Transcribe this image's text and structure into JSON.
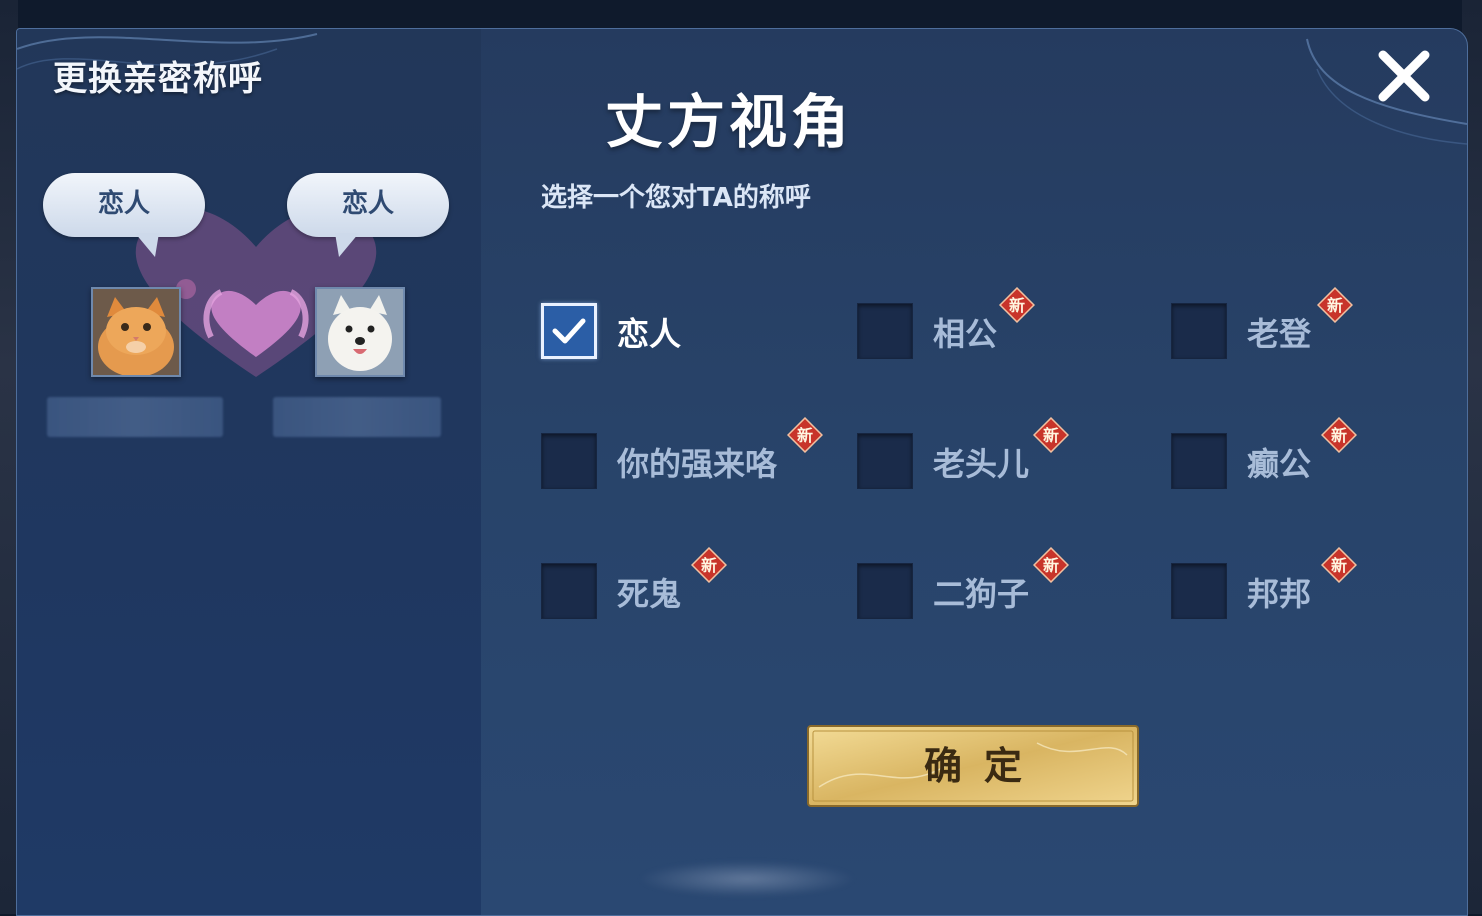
{
  "dialog": {
    "title": "更换亲密称呼",
    "perspective_title": "丈方视角",
    "prompt": "选择一个您对TA的称呼",
    "close_icon": "close-icon"
  },
  "couple": {
    "left_bubble": "恋人",
    "right_bubble": "恋人",
    "left_avatar": "orange-cat-avatar",
    "right_avatar": "white-dog-avatar"
  },
  "options": [
    {
      "label": "恋人",
      "checked": true,
      "new": false
    },
    {
      "label": "相公",
      "checked": false,
      "new": true
    },
    {
      "label": "老登",
      "checked": false,
      "new": true
    },
    {
      "label": "你的强来咯",
      "checked": false,
      "new": true
    },
    {
      "label": "老头儿",
      "checked": false,
      "new": true
    },
    {
      "label": "癫公",
      "checked": false,
      "new": true
    },
    {
      "label": "死鬼",
      "checked": false,
      "new": true
    },
    {
      "label": "二狗子",
      "checked": false,
      "new": true
    },
    {
      "label": "邦邦",
      "checked": false,
      "new": true
    }
  ],
  "new_badge_text": "新",
  "confirm_label": "确定",
  "colors": {
    "panel": "#284369",
    "checkbox_selected": "#2b5ea6",
    "badge_red": "#c8342a",
    "confirm_gold": "#d9b562"
  }
}
